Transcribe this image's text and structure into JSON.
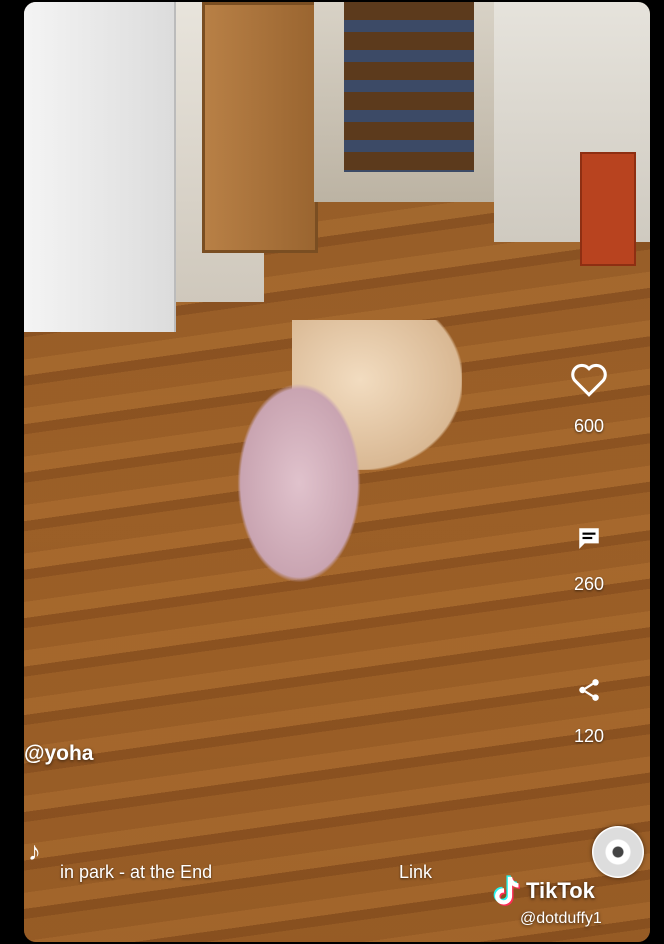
{
  "video": {
    "username": "@yoha",
    "sound_title": "in park - at the End",
    "link_label": "Link"
  },
  "actions": {
    "like_count": "600",
    "comment_count": "260",
    "share_count": "120"
  },
  "watermark": {
    "brand": "TikTok",
    "handle": "@dotduffy1"
  },
  "icons": {
    "like": "heart-icon",
    "comment": "comment-icon",
    "share": "share-icon",
    "music": "music-note-icon",
    "disc": "music-disc-icon",
    "brand": "tiktok-logo-icon"
  },
  "colors": {
    "overlay_text": "#ffffff",
    "frame": "#000000"
  }
}
